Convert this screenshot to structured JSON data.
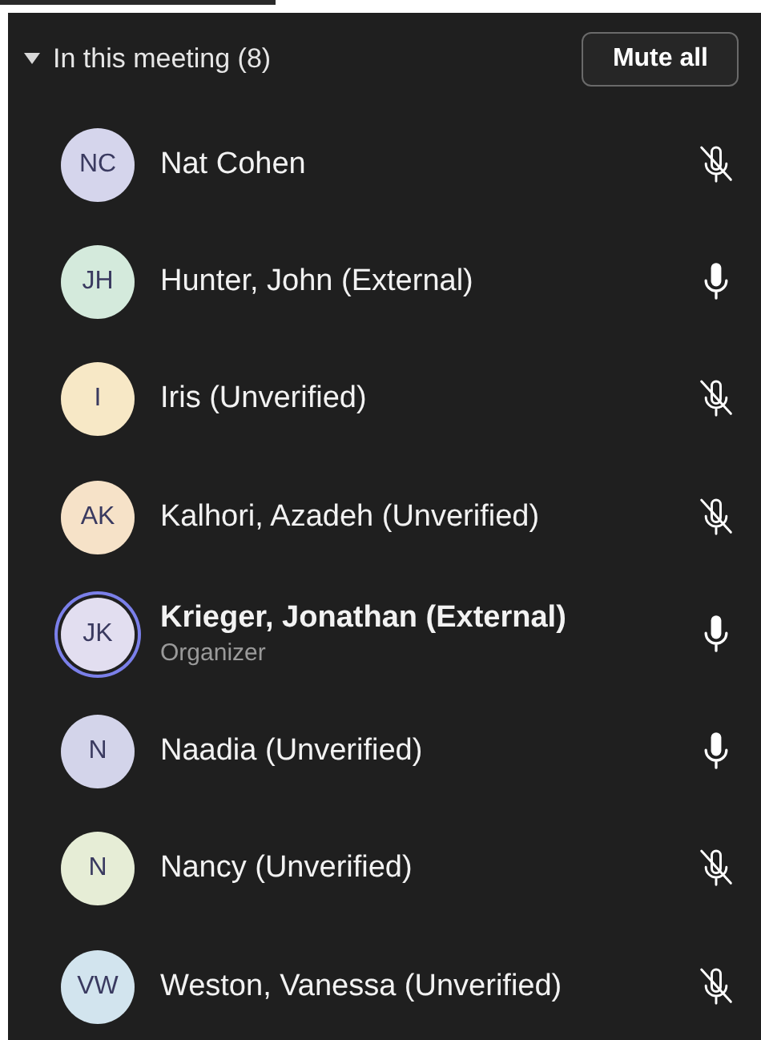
{
  "section": {
    "title": "In this meeting (8)",
    "expanded": true,
    "mute_all_button": "Mute all"
  },
  "participants": [
    {
      "initials": "NC",
      "name": "Nat Cohen",
      "color": "#d5d5ec",
      "muted": true,
      "speaking": false
    },
    {
      "initials": "JH",
      "name": "Hunter, John (External)",
      "color": "#d4eadc",
      "muted": false,
      "speaking": false
    },
    {
      "initials": "I",
      "name": "Iris (Unverified)",
      "color": "#f7e8c6",
      "muted": true,
      "speaking": false
    },
    {
      "initials": "AK",
      "name": "Kalhori, Azadeh (Unverified)",
      "color": "#f6e2c8",
      "muted": true,
      "speaking": false
    },
    {
      "initials": "JK",
      "name": "Krieger, Jonathan (External)",
      "role": "Organizer",
      "color": "#e2def0",
      "muted": false,
      "speaking": true
    },
    {
      "initials": "N",
      "name": "Naadia (Unverified)",
      "color": "#d3d4ea",
      "muted": false,
      "speaking": false
    },
    {
      "initials": "N",
      "name": "Nancy (Unverified)",
      "color": "#e6edd6",
      "muted": true,
      "speaking": false
    },
    {
      "initials": "VW",
      "name": "Weston, Vanessa (Unverified)",
      "color": "#d2e4ee",
      "muted": true,
      "speaking": false
    }
  ]
}
